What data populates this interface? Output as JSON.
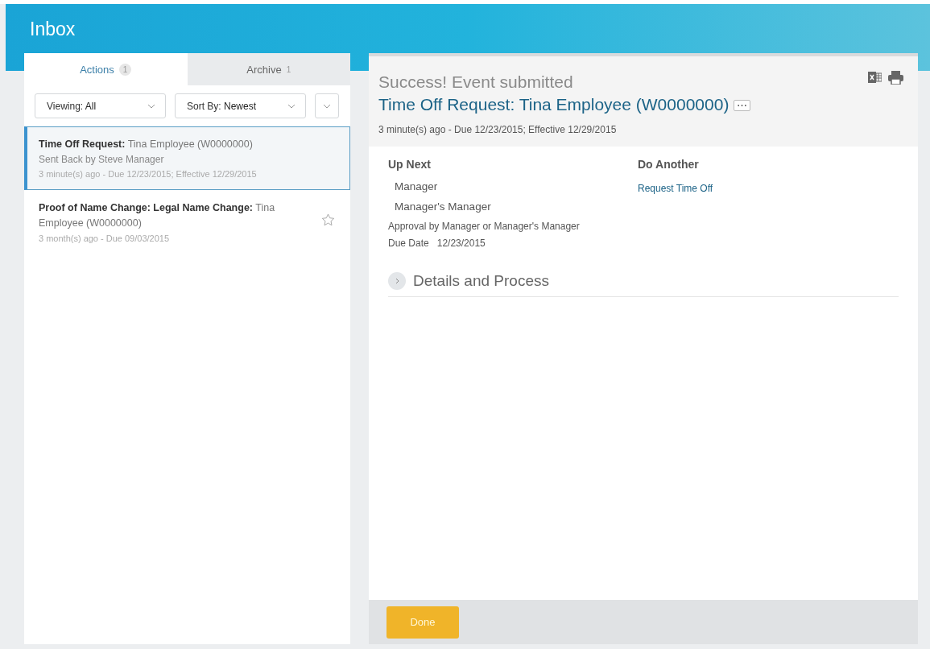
{
  "header": {
    "title": "Inbox"
  },
  "tabs": [
    {
      "label": "Actions",
      "count": "1",
      "selected": true
    },
    {
      "label": "Archive",
      "count": "1",
      "selected": false
    }
  ],
  "filters": [
    {
      "label": "Viewing:",
      "value": "All"
    },
    {
      "label": "Sort By:",
      "value": "Newest"
    }
  ],
  "items": [
    {
      "title": "**Time Off Request:** Tina Employee (W0000000)",
      "subtitle": "Sent Back by Steve Manager",
      "meta": "3 minute(s) ago - Due 12/23/2015; Effective 12/29/2015",
      "selected": true,
      "star_shown": false
    },
    {
      "title": "**Proof of Name Change: Legal Name Change:** Tina Employee (W0000000)",
      "meta": "3 month(s) ago - Due 09/03/2015",
      "selected": false,
      "star_shown": true
    }
  ],
  "detail": {
    "status": "Success! Event submitted",
    "event_link": "Time Off Request: Tina Employee (W0000000)",
    "more": "⋯",
    "meta": "3 minute(s) ago - Due 12/23/2015; Effective 12/29/2015",
    "up_next": {
      "heading": "Up Next",
      "steps": [
        "Manager",
        "Manager's Manager"
      ],
      "approval": "Approval by Manager or Manager's Manager",
      "due_label": "Due Date",
      "due_value": "12/23/2015"
    },
    "do_another": {
      "heading": "Do Another",
      "links": [
        "Request Time Off"
      ]
    },
    "section": {
      "label": "Details and Process",
      "expanded": false
    },
    "done": "Done"
  }
}
